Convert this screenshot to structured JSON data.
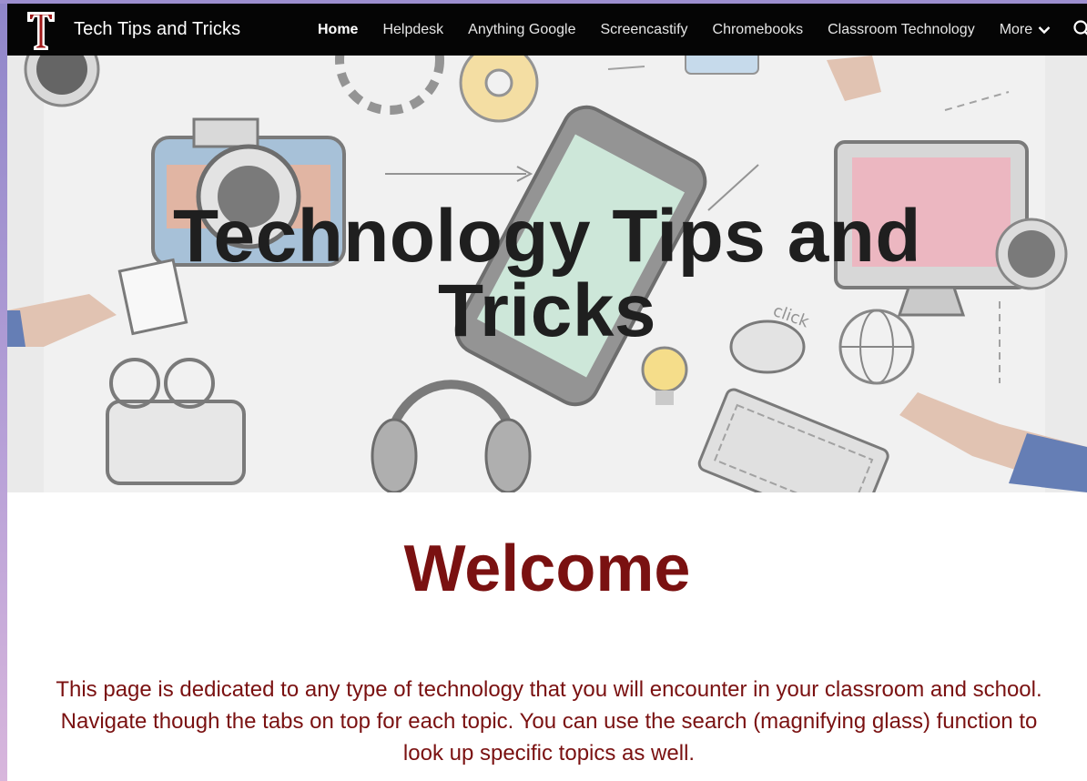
{
  "header": {
    "site_title": "Tech Tips and Tricks",
    "logo_letter": "T",
    "nav": [
      {
        "label": "Home",
        "active": true
      },
      {
        "label": "Helpdesk",
        "active": false
      },
      {
        "label": "Anything Google",
        "active": false
      },
      {
        "label": "Screencastify",
        "active": false
      },
      {
        "label": "Chromebooks",
        "active": false
      },
      {
        "label": "Classroom Technology",
        "active": false
      }
    ],
    "more_label": "More",
    "icons": {
      "search": "search-icon",
      "more": "chevron-down-icon",
      "logo": "t-logo"
    }
  },
  "hero": {
    "title_line1": "Technology Tips and",
    "title_line2": "Tricks",
    "doodle_text": "click"
  },
  "welcome": {
    "heading": "Welcome",
    "body": "This page is dedicated to any type of technology that you will encounter in your classroom and school. Navigate though the tabs on top for each topic. You can use the search (magnifying glass) function to look up specific topics as well."
  },
  "colors": {
    "nav_bg": "#050505",
    "accent": "#7a1111",
    "hero_title": "#1f1f1f"
  }
}
